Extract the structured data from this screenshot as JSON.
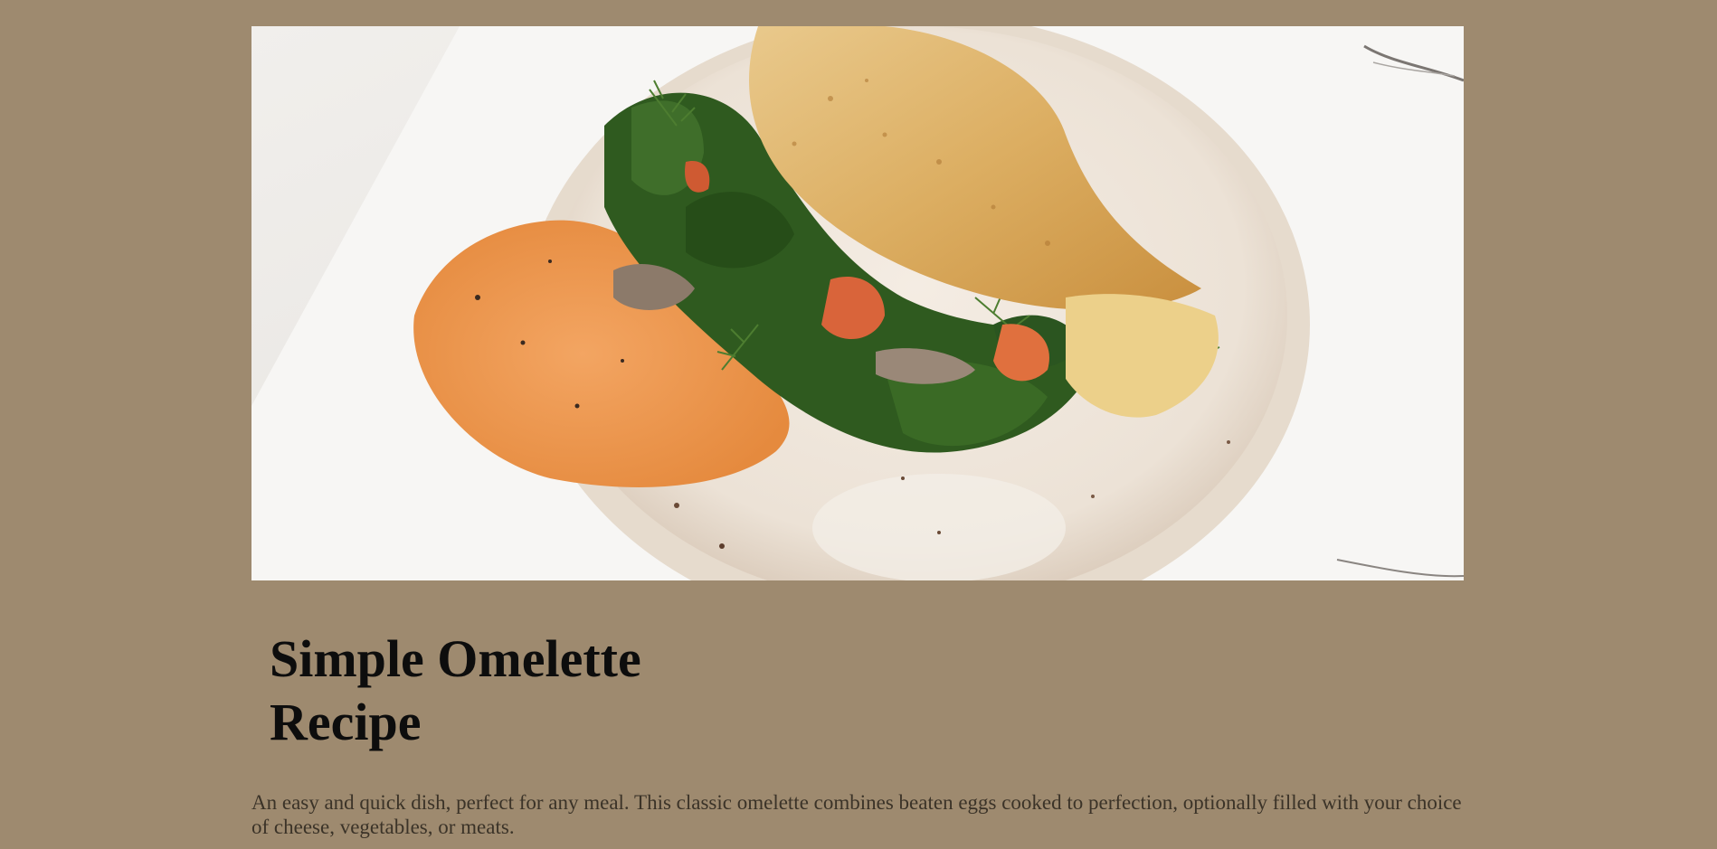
{
  "recipe": {
    "title": "Simple Omelette Recipe",
    "description": "An easy and quick dish, perfect for any meal. This classic omelette combines beaten eggs cooked to perfection, optionally filled with your choice of cheese, vegetables, or meats."
  },
  "colors": {
    "page_background": "#9e8a6f",
    "title_text": "#0d0d0d",
    "body_text": "#3b3328"
  },
  "hero_image": {
    "subject": "omelette-with-spinach-dill-and-hummus-on-plate"
  }
}
